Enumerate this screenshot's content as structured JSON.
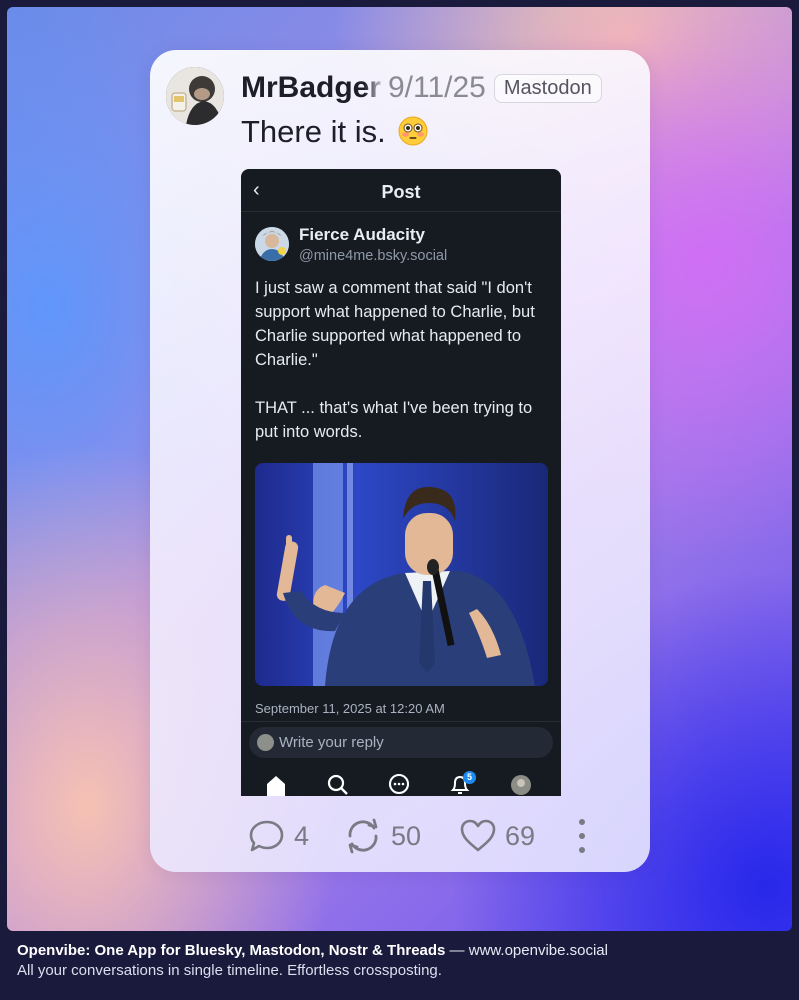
{
  "post": {
    "author": "MrBadger",
    "date": "9/11/25",
    "network": "Mastodon",
    "text": "There it is.",
    "emoji": "flushed-face-emoji",
    "stats": {
      "replies": "4",
      "reposts": "50",
      "likes": "69"
    }
  },
  "embedded_screenshot": {
    "header_title": "Post",
    "author_name": "Fierce Audacity",
    "author_handle": "@mine4me.bsky.social",
    "body": "I just saw a comment that said \"I don't support what happened to Charlie, but Charlie supported what happened to Charlie.\"\n\nTHAT ... that's what I've been trying to put into words.",
    "timestamp": "September 11, 2025 at 12:20 AM",
    "reply_placeholder": "Write your reply",
    "notification_badge": "5",
    "tabs": [
      "home-icon",
      "search-icon",
      "chat-icon",
      "bell-icon",
      "profile-avatar"
    ]
  },
  "footer": {
    "brand": "Openvibe: One App for Bluesky, Mastodon, Nostr & Threads",
    "separator": " — ",
    "url": "www.openvibe.social",
    "tagline": "All your conversations in single timeline. Effortless crossposting."
  },
  "colors": {
    "accent_blue": "#1d8cf2",
    "dark_panel": "#161b22",
    "muted_text": "#7a7a85"
  }
}
